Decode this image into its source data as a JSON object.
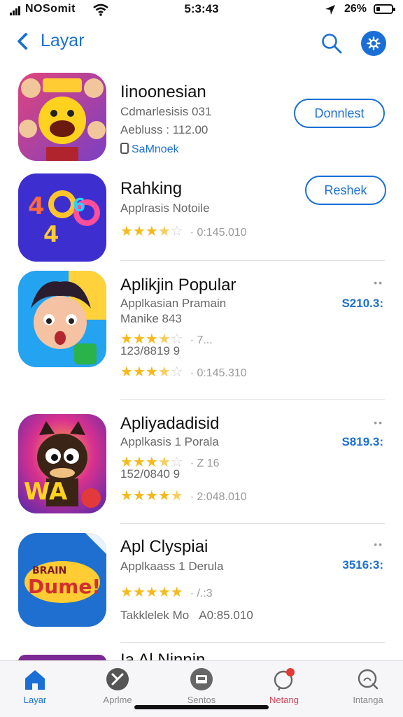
{
  "status": {
    "carrier": "NOSomit",
    "time": "5:3:43",
    "battery": "26%",
    "battery_level": 0.26
  },
  "nav": {
    "back_label": "Layar"
  },
  "apps": [
    {
      "title": "Iinoonesian",
      "line1": "Cdmarlesisis 031",
      "line2": "Aebluss : 112.00",
      "link": "SaMnoek",
      "button": "Donnlest"
    },
    {
      "title": "Rahking",
      "line1": "Applrasis Notoile",
      "button": "Reshek",
      "rating": 3.5,
      "rating_text": "0:145.010"
    },
    {
      "title": "Aplikjin Popular",
      "line1": "Applkasian Pramain",
      "line2": "Manike 843",
      "stars_a": 3.5,
      "stars_a_text": "7...",
      "line3": "123/8819 9",
      "rating": 3.5,
      "rating_text": "0:145.310",
      "price": "S210.3:"
    },
    {
      "title": "Apliyadadisid",
      "line1": "Applkasis 1 Porala",
      "stars_a": 3.5,
      "stars_a_text": "Z 16",
      "line2": "152/0840 9",
      "rating": 4.5,
      "rating_text": "2:048.010",
      "price": "S819.3:"
    },
    {
      "title": "Apl Clyspiai",
      "line1": "Applkaass 1 Derula",
      "rating": 5,
      "rating_text": "/.:3",
      "line2": "Takklelek Mo",
      "line2b": "A0:85.010",
      "price": "3516:3:"
    }
  ],
  "partial_title": "Ia Al Ninnin",
  "tabs": [
    {
      "label": "Layar",
      "icon": "home-icon",
      "active": true
    },
    {
      "label": "Aprlme",
      "icon": "apps-icon"
    },
    {
      "label": "Sentos",
      "icon": "games-icon"
    },
    {
      "label": "Netang",
      "icon": "notification-icon"
    },
    {
      "label": "Intanga",
      "icon": "search-tab-icon"
    }
  ],
  "colors": {
    "accent": "#1a6fd6",
    "star": "#f5b91a",
    "badge": "#e53935"
  }
}
